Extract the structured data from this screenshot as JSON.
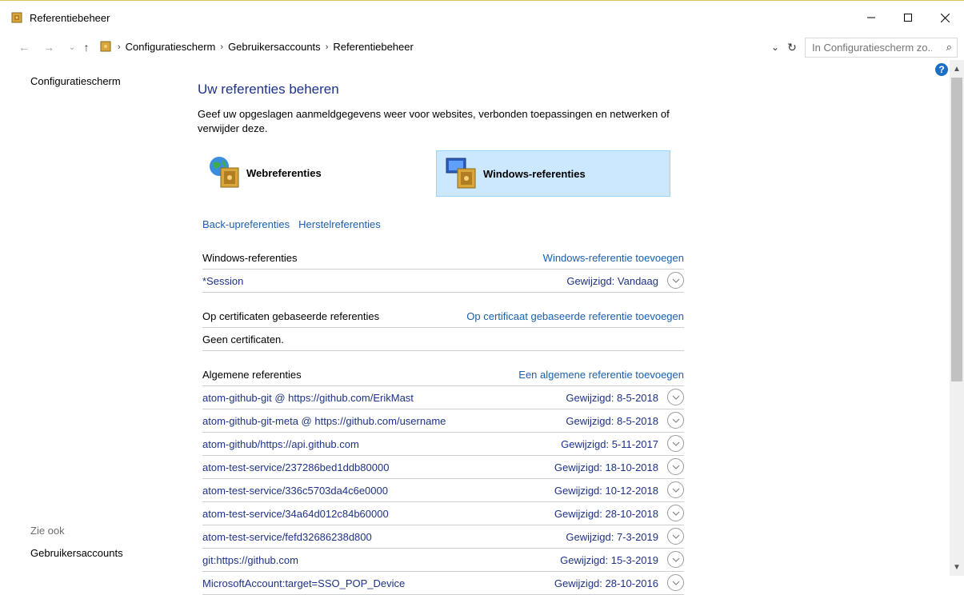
{
  "window": {
    "title": "Referentiebeheer"
  },
  "address": {
    "crumbs": [
      "Configuratiescherm",
      "Gebruikersaccounts",
      "Referentiebeheer"
    ],
    "search_placeholder": "In Configuratiescherm zo..."
  },
  "left": {
    "home": "Configuratiescherm",
    "see_also": "Zie ook",
    "useraccounts": "Gebruikersaccounts"
  },
  "main": {
    "heading": "Uw referenties beheren",
    "description": "Geef uw opgeslagen aanmeldgegevens weer voor websites, verbonden toepassingen en netwerken of verwijder deze.",
    "tiles": [
      {
        "label": "Webreferenties",
        "selected": false
      },
      {
        "label": "Windows-referenties",
        "selected": true
      }
    ],
    "links": [
      "Back-upreferenties",
      "Herstelreferenties"
    ]
  },
  "sections": {
    "windows": {
      "title": "Windows-referenties",
      "add": "Windows-referentie toevoegen",
      "rows": [
        {
          "name": "*Session",
          "modified": "Gewijzigd: Vandaag"
        }
      ]
    },
    "cert": {
      "title": "Op certificaten gebaseerde referenties",
      "add": "Op certificaat gebaseerde referentie toevoegen",
      "empty": "Geen certificaten."
    },
    "general": {
      "title": "Algemene referenties",
      "add": "Een algemene referentie toevoegen",
      "rows": [
        {
          "name": "atom-github-git @ https://github.com/ErikMast",
          "modified": "Gewijzigd: 8-5-2018"
        },
        {
          "name": "atom-github-git-meta @ https://github.com/username",
          "modified": "Gewijzigd: 8-5-2018"
        },
        {
          "name": "atom-github/https://api.github.com",
          "modified": "Gewijzigd: 5-11-2017"
        },
        {
          "name": "atom-test-service/237286bed1ddb80000",
          "modified": "Gewijzigd: 18-10-2018"
        },
        {
          "name": "atom-test-service/336c5703da4c6e0000",
          "modified": "Gewijzigd: 10-12-2018"
        },
        {
          "name": "atom-test-service/34a64d012c84b60000",
          "modified": "Gewijzigd: 28-10-2018"
        },
        {
          "name": "atom-test-service/fefd32686238d800",
          "modified": "Gewijzigd: 7-3-2019"
        },
        {
          "name": "git:https://github.com",
          "modified": "Gewijzigd: 15-3-2019"
        },
        {
          "name": "MicrosoftAccount:target=SSO_POP_Device",
          "modified": "Gewijzigd: 28-10-2016"
        }
      ]
    }
  }
}
